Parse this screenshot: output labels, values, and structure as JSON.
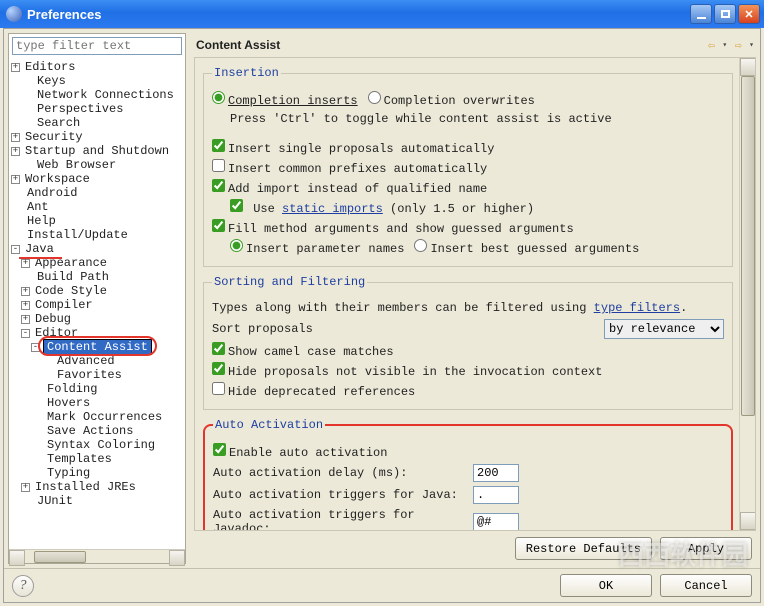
{
  "window": {
    "title": "Preferences"
  },
  "filter": {
    "placeholder": "type filter text"
  },
  "tree": {
    "items": [
      {
        "depth": 0,
        "toggle": "+",
        "label": "Editors"
      },
      {
        "depth": 1,
        "toggle": "",
        "label": "Keys"
      },
      {
        "depth": 1,
        "toggle": "",
        "label": "Network Connections"
      },
      {
        "depth": 1,
        "toggle": "",
        "label": "Perspectives"
      },
      {
        "depth": 1,
        "toggle": "",
        "label": "Search"
      },
      {
        "depth": 0,
        "toggle": "+",
        "label": "Security"
      },
      {
        "depth": 0,
        "toggle": "+",
        "label": "Startup and Shutdown"
      },
      {
        "depth": 1,
        "toggle": "",
        "label": "Web Browser"
      },
      {
        "depth": 0,
        "toggle": "+",
        "label": "Workspace"
      },
      {
        "depth": 0,
        "toggle": "",
        "label": "Android"
      },
      {
        "depth": 0,
        "toggle": "",
        "label": "Ant"
      },
      {
        "depth": 0,
        "toggle": "",
        "label": "Help"
      },
      {
        "depth": 0,
        "toggle": "",
        "label": "Install/Update"
      },
      {
        "depth": 0,
        "toggle": "-",
        "label": "Java",
        "annotated": "underline"
      },
      {
        "depth": 1,
        "toggle": "+",
        "label": "Appearance"
      },
      {
        "depth": 1,
        "toggle": "",
        "label": "Build Path"
      },
      {
        "depth": 1,
        "toggle": "+",
        "label": "Code Style"
      },
      {
        "depth": 1,
        "toggle": "+",
        "label": "Compiler"
      },
      {
        "depth": 1,
        "toggle": "+",
        "label": "Debug"
      },
      {
        "depth": 1,
        "toggle": "-",
        "label": "Editor"
      },
      {
        "depth": 2,
        "toggle": "-",
        "label": "Content Assist",
        "selected": true,
        "annotated": "oval"
      },
      {
        "depth": 3,
        "toggle": "",
        "label": "Advanced"
      },
      {
        "depth": 3,
        "toggle": "",
        "label": "Favorites"
      },
      {
        "depth": 2,
        "toggle": "",
        "label": "Folding"
      },
      {
        "depth": 2,
        "toggle": "",
        "label": "Hovers"
      },
      {
        "depth": 2,
        "toggle": "",
        "label": "Mark Occurrences"
      },
      {
        "depth": 2,
        "toggle": "",
        "label": "Save Actions"
      },
      {
        "depth": 2,
        "toggle": "",
        "label": "Syntax Coloring"
      },
      {
        "depth": 2,
        "toggle": "",
        "label": "Templates"
      },
      {
        "depth": 2,
        "toggle": "",
        "label": "Typing"
      },
      {
        "depth": 1,
        "toggle": "+",
        "label": "Installed JREs"
      },
      {
        "depth": 1,
        "toggle": "",
        "label": "JUnit"
      }
    ]
  },
  "page": {
    "title": "Content Assist",
    "insertion": {
      "legend": "Insertion",
      "radio_inserts": "Completion inserts",
      "radio_overwrites": "Completion overwrites",
      "toggle_note": "Press 'Ctrl' to toggle while content assist is active",
      "single_proposals": {
        "label": "Insert single proposals automatically",
        "checked": true
      },
      "common_prefixes": {
        "label": "Insert common prefixes automatically",
        "checked": false
      },
      "add_import": {
        "label": "Add import instead of qualified name",
        "checked": true
      },
      "use_static": {
        "prefix": "Use ",
        "link": "static imports",
        "suffix": " (only 1.5 or higher)",
        "checked": true
      },
      "fill_method": {
        "label": "Fill method arguments and show guessed arguments",
        "checked": true
      },
      "fill_radio_insert": "Insert parameter names",
      "fill_radio_best": "Insert best guessed arguments"
    },
    "sorting": {
      "legend": "Sorting and Filtering",
      "type_filter_note_prefix": "Types along with their members can be filtered using ",
      "type_filter_link": "type filters",
      "type_filter_note_suffix": ".",
      "sort_label": "Sort proposals",
      "sort_value": "by relevance",
      "camel": {
        "label": "Show camel case matches",
        "checked": true
      },
      "hide_invoc": {
        "label": "Hide proposals not visible in the invocation context",
        "checked": true
      },
      "hide_dep": {
        "label": "Hide deprecated references",
        "checked": false
      }
    },
    "auto": {
      "legend": "Auto Activation",
      "enable": {
        "label": "Enable auto activation",
        "checked": true
      },
      "delay": {
        "label": "Auto activation delay (ms):",
        "value": "200"
      },
      "trig_java": {
        "label": "Auto activation triggers for Java:",
        "value": "."
      },
      "trig_doc": {
        "label": "Auto activation triggers for Javadoc:",
        "value": "@#"
      }
    },
    "buttons": {
      "restore": "Restore Defaults",
      "apply": "Apply",
      "ok": "OK",
      "cancel": "Cancel"
    }
  },
  "watermark": "西西软件园"
}
